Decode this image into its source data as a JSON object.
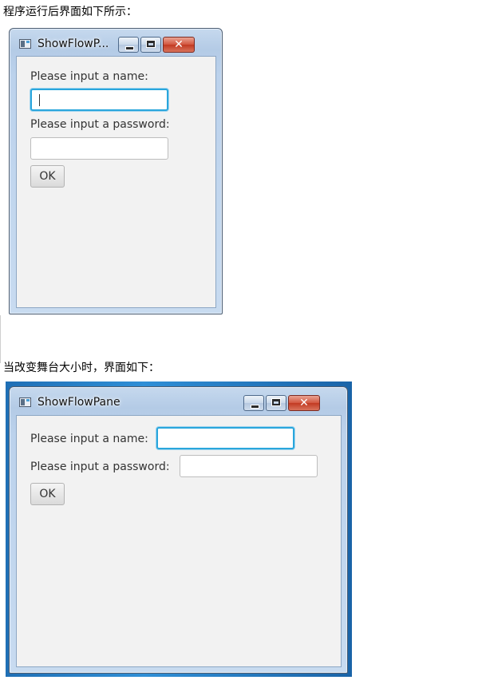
{
  "captions": {
    "first": "程序运行后界面如下所示：",
    "second": "当改变舞台大小时，界面如下："
  },
  "window1": {
    "title": "ShowFlowP...",
    "name_label": "Please input a name:",
    "name_value": "",
    "password_label": "Please input a password:",
    "password_value": "",
    "ok_label": "OK"
  },
  "window2": {
    "title": "ShowFlowPane",
    "name_label": "Please input a name:",
    "name_value": "",
    "password_label": "Please input a password:",
    "password_value": "",
    "ok_label": "OK"
  },
  "colors": {
    "focus_ring": "#2aa6dc",
    "close_button": "#c23a22",
    "client_background": "#f2f2f2"
  }
}
